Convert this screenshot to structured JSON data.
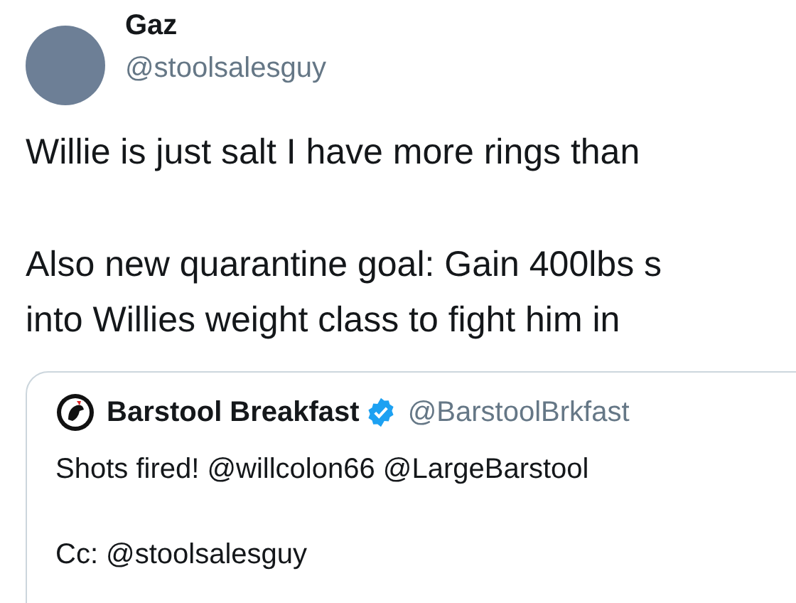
{
  "author": {
    "name": "Gaz",
    "handle": "@stoolsalesguy"
  },
  "tweet": {
    "paragraphs": [
      [
        "Willie is just salt I have more rings than"
      ],
      [
        "Also new quarantine goal: Gain 400lbs s",
        "into Willies weight class to fight him in"
      ]
    ]
  },
  "quoted_tweet": {
    "name": "Barstool Breakfast",
    "verified": true,
    "handle": "@BarstoolBrkfast",
    "paragraphs": [
      [
        "Shots fired! @willcolon66 @LargeBarstool"
      ],
      [
        "Cc: @stoolsalesguy"
      ]
    ]
  }
}
